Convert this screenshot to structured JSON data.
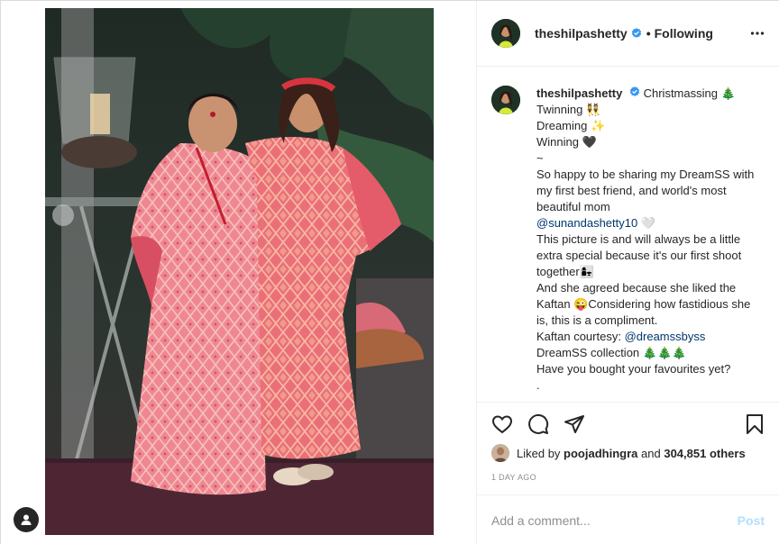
{
  "post": {
    "username": "theshilpashetty",
    "verified": true,
    "follow_status": "Following",
    "separator": "•",
    "more_icon": "more-horizontal-icon"
  },
  "caption": {
    "username": "theshilpashetty",
    "lines": [
      "Christmassing 🎄",
      "Twinning 👯",
      "Dreaming ✨",
      "Winning 🖤",
      "~",
      "So happy to be sharing my DreamSS with my first best friend, and world's most beautiful mom",
      "@sunandashetty10",
      "This picture is and will always be a little extra special because it's our first shoot together👩‍👧",
      "And she agreed because she liked the Kaftan 😜Considering how fastidious she is, this is a compliment.",
      "Kaftan courtesy:",
      "@dreamssbyss",
      "DreamSS collection 🎄🎄🎄",
      "Have you bought your favourites yet?",
      "."
    ]
  },
  "actions": {
    "like_icon": "heart-icon",
    "comment_icon": "comment-icon",
    "share_icon": "share-icon",
    "save_icon": "bookmark-icon"
  },
  "likes": {
    "prefix": "Liked by",
    "user": "poojadhingra",
    "middle": "and",
    "count": "304,851 others"
  },
  "date": "1 DAY AGO",
  "comment": {
    "placeholder": "Add a comment...",
    "post_label": "Post"
  },
  "colors": {
    "verified_blue": "#3897f0",
    "link_blue": "#00376b",
    "post_disabled": "#b2dffc",
    "kaftan_pink": "#e8707a"
  }
}
